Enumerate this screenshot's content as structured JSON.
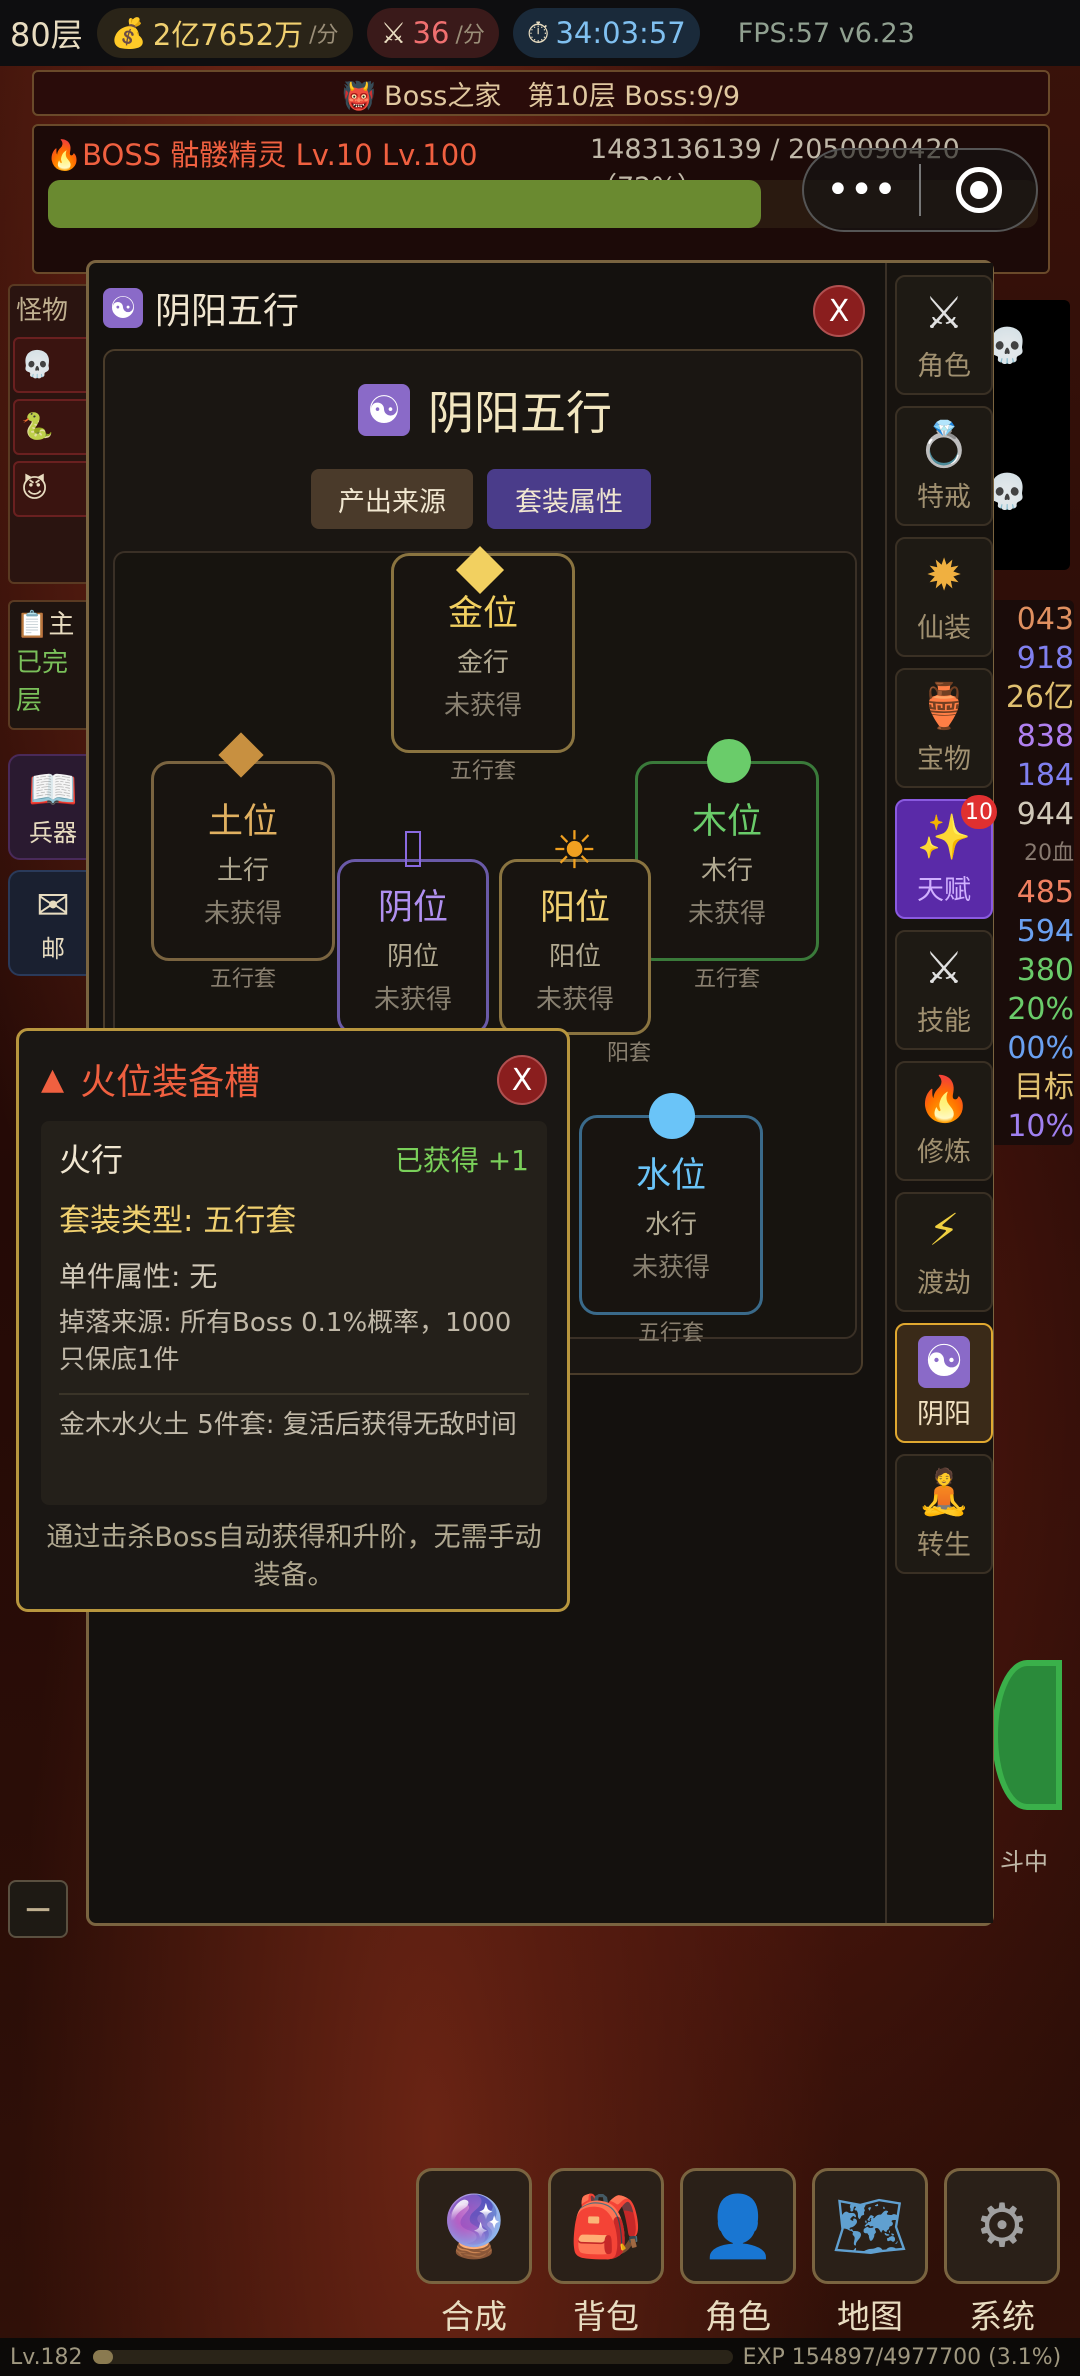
{
  "topbar": {
    "floor": "80层",
    "gold": "2亿7652万",
    "gold_unit": "/分",
    "kills": "36",
    "kills_unit": "/分",
    "timer": "34:03:57",
    "fps": "FPS:57 v6.23"
  },
  "boss_home": {
    "title": "Boss之家",
    "floor": "第10层 Boss:9/9"
  },
  "boss": {
    "name": "BOSS 骷髅精灵 Lv.10 Lv.100",
    "hp": "1483136139 / 2050090420（72%）",
    "hp_fraction": 0.72
  },
  "left_panel": {
    "title": "怪物",
    "quest_title": "主",
    "quest_status": "已完",
    "quest_floor": "层",
    "btn1": "兵器",
    "btn2": "邮"
  },
  "right_stats": [
    "043",
    "918",
    "26亿",
    "838",
    "184",
    "944",
    "20血",
    "485",
    "594",
    "380",
    "20%",
    "00%",
    "目标",
    "10%"
  ],
  "right_status": "斗中",
  "dialog": {
    "title": "阴阳五行",
    "close": "X",
    "heading": "阴阳五行",
    "tab_source": "产出来源",
    "tab_set": "套装属性"
  },
  "slots": [
    {
      "id": "metal",
      "name": "金位",
      "element": "金行",
      "status": "未获得",
      "tag": "五行套"
    },
    {
      "id": "earth",
      "name": "土位",
      "element": "土行",
      "status": "未获得",
      "tag": "五行套"
    },
    {
      "id": "wood",
      "name": "木位",
      "element": "木行",
      "status": "未获得",
      "tag": "五行套"
    },
    {
      "id": "yin",
      "name": "阴位",
      "element": "阴位",
      "status": "未获得",
      "tag": ""
    },
    {
      "id": "yang",
      "name": "阳位",
      "element": "阳位",
      "status": "未获得",
      "tag": "阳套"
    },
    {
      "id": "water",
      "name": "水位",
      "element": "水行",
      "status": "未获得",
      "tag": "五行套"
    }
  ],
  "nav": [
    {
      "icon": "⚔",
      "label": "角色"
    },
    {
      "icon": "💍",
      "label": "特戒"
    },
    {
      "icon": "✹",
      "label": "仙装"
    },
    {
      "icon": "🏺",
      "label": "宝物"
    },
    {
      "icon": "✨",
      "label": "天赋",
      "badge": "10"
    },
    {
      "icon": "⚔",
      "label": "技能"
    },
    {
      "icon": "🔥",
      "label": "修炼"
    },
    {
      "icon": "⚡",
      "label": "渡劫"
    },
    {
      "icon": "☯",
      "label": "阴阳"
    },
    {
      "icon": "🧘",
      "label": "转生"
    }
  ],
  "popup": {
    "title": "火位装备槽",
    "close": "X",
    "element": "火行",
    "obtained": "已获得 +1",
    "set_type": "套装类型: 五行套",
    "single_attr": "单件属性: 无",
    "drop": "掉落来源: 所有Boss 0.1%概率，1000只保底1件",
    "set_bonus": "金木水火土 5件套: 复活后获得无敌时间",
    "footer": "通过击杀Boss自动获得和升阶，无需手动装备。"
  },
  "bottom_controls": {
    "minus": "−"
  },
  "bottom_nav": [
    {
      "icon": "🔮",
      "label": "合成"
    },
    {
      "icon": "🎒",
      "label": "背包"
    },
    {
      "icon": "👤",
      "label": "角色"
    },
    {
      "icon": "🗺",
      "label": "地图"
    },
    {
      "icon": "⚙",
      "label": "系统"
    }
  ],
  "footer": {
    "level": "Lv.182",
    "exp": "EXP 154897/4977700 (3.1%)",
    "exp_fraction": 0.031
  },
  "colors": {
    "metal_marker": "#f2d060",
    "earth_marker": "#c89040",
    "wood_marker": "#6acc6a",
    "water_marker": "#6ac4f8",
    "yin_border": "#6a5aa8",
    "active_tab": "#4a3c8a"
  }
}
